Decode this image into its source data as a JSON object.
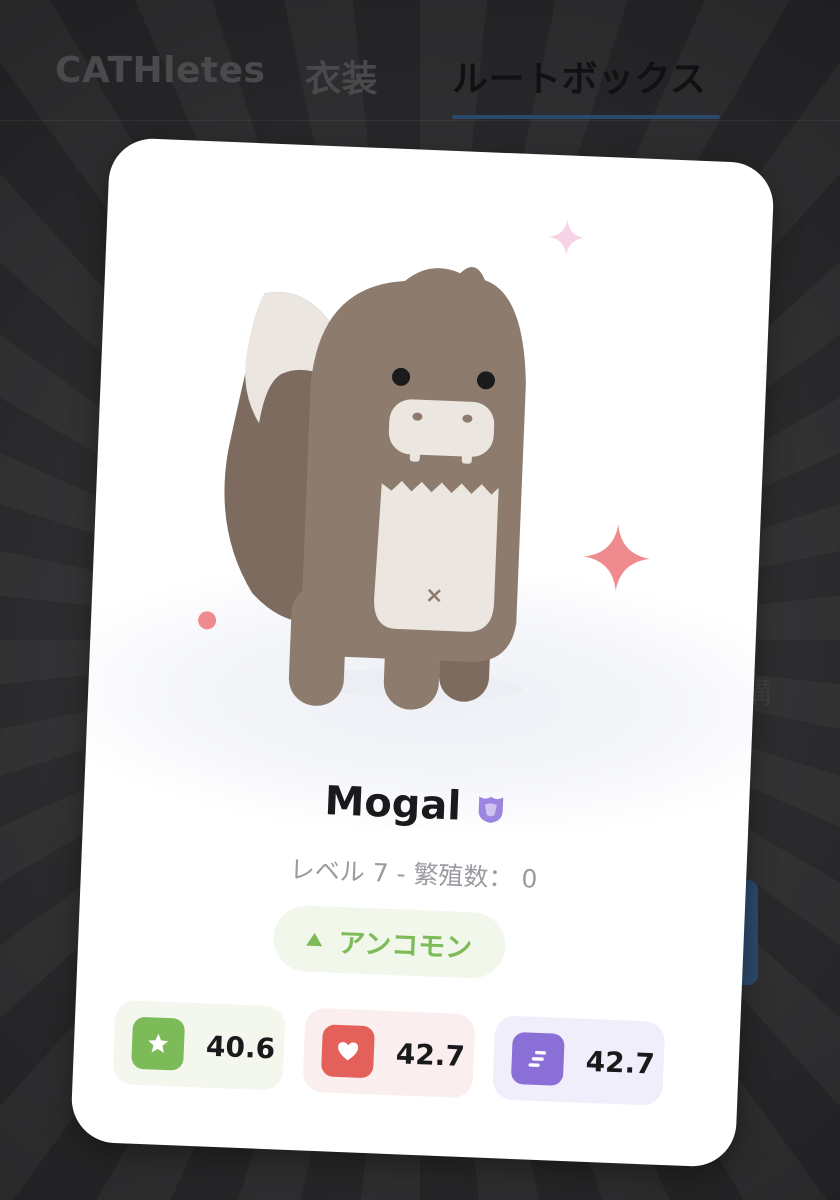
{
  "tabs": [
    {
      "label": "CATHletes"
    },
    {
      "label": "衣装"
    },
    {
      "label": "ルートボックス"
    }
  ],
  "background": {
    "right_char": "構"
  },
  "card": {
    "name": "Mogal",
    "level_text": "レベル 7 - 繁殖数： 0",
    "rarity": "アンコモン",
    "stats": [
      {
        "icon": "star-icon",
        "value": "40.6",
        "color": "#7cbb57"
      },
      {
        "icon": "heart-icon",
        "value": "42.7",
        "color": "#e4605a"
      },
      {
        "icon": "speed-icon",
        "value": "42.7",
        "color": "#8a6fd6"
      }
    ]
  },
  "colors": {
    "active_tab_underline": "#2b4a6b",
    "rarity_green": "#7cbb57",
    "stat_green": "#7cbb57",
    "stat_red": "#e4605a",
    "stat_purple": "#8a6fd6",
    "creature_brown": "#8d7b6d"
  }
}
